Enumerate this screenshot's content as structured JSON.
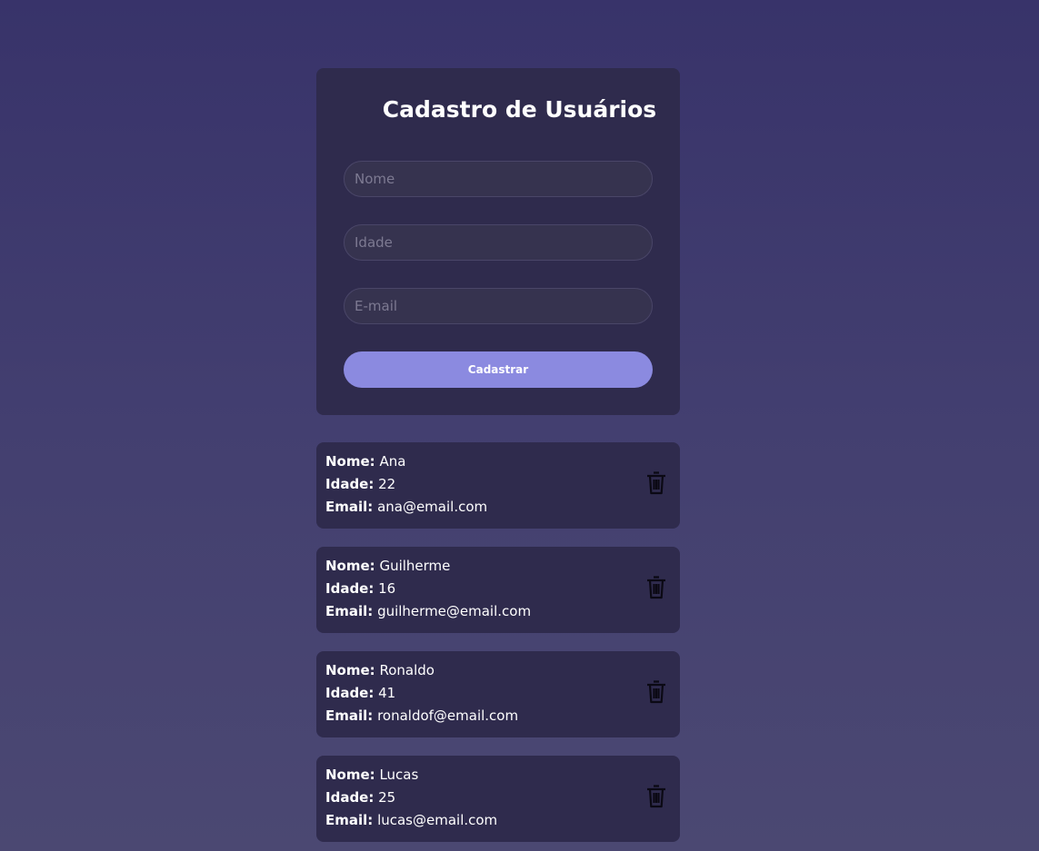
{
  "form": {
    "title": "Cadastro de Usuários",
    "name_placeholder": "Nome",
    "age_placeholder": "Idade",
    "email_placeholder": "E-mail",
    "submit_label": "Cadastrar"
  },
  "labels": {
    "name": "Nome:",
    "age": "Idade:",
    "email": "Email:"
  },
  "icons": {
    "delete": "trash-icon"
  },
  "colors": {
    "accent": "#8b8ae0",
    "card": "#2f2b4d"
  },
  "users": [
    {
      "name": "Ana",
      "age": "22",
      "email": "ana@email.com"
    },
    {
      "name": "Guilherme",
      "age": "16",
      "email": "guilherme@email.com"
    },
    {
      "name": "Ronaldo",
      "age": "41",
      "email": "ronaldof@email.com"
    },
    {
      "name": "Lucas",
      "age": "25",
      "email": "lucas@email.com"
    }
  ]
}
